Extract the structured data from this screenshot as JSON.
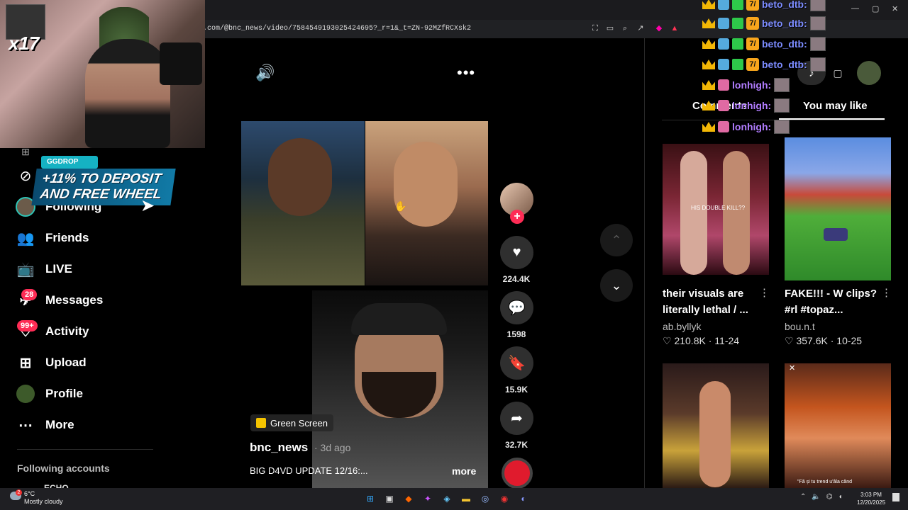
{
  "browser": {
    "url": "k.com/@bnc_news/video/7584549193025424695?_r=1&_t=ZN-92MZfRCXsk2",
    "window_controls": [
      "—",
      "▢",
      "✕"
    ]
  },
  "stream": {
    "viewer_multiplier": "x17",
    "promo_pill": "GGDROP",
    "promo_text": "+11% TO DEPOSIT AND FREE WHEEL"
  },
  "nav": {
    "items": [
      {
        "label": "Following",
        "icon": "following-avatar-icon"
      },
      {
        "label": "Friends",
        "icon": "friends-icon"
      },
      {
        "label": "LIVE",
        "icon": "live-tv-icon"
      },
      {
        "label": "Messages",
        "icon": "messages-icon",
        "badge": "28"
      },
      {
        "label": "Activity",
        "icon": "activity-icon",
        "badge": "99+"
      },
      {
        "label": "Upload",
        "icon": "upload-icon"
      },
      {
        "label": "Profile",
        "icon": "profile-avatar-icon"
      },
      {
        "label": "More",
        "icon": "more-icon"
      }
    ],
    "following_header": "Following accounts",
    "following_first": "ECHO"
  },
  "video": {
    "tag": "Green Screen",
    "author": "bnc_news",
    "date": "· 3d ago",
    "caption": "BIG D4VD UPDATE 12/16:...",
    "more_label": "more"
  },
  "actions": {
    "likes": "224.4K",
    "comments": "1598",
    "saves": "15.9K",
    "shares": "32.7K"
  },
  "right_panel": {
    "tab_comments": "Comments",
    "tab_you_may_like": "You may like",
    "cards": [
      {
        "title": "their visuals are literally lethal / ...",
        "author": "ab.byllyk",
        "likes": "210.8K",
        "date": "11-24"
      },
      {
        "title": "FAKE!!! - W clips? #rl #topaz...",
        "author": "bou.n.t",
        "likes": "357.6K",
        "date": "10-25"
      },
      {
        "title": "",
        "author": "",
        "likes": "",
        "date": ""
      },
      {
        "title": "",
        "author": "",
        "likes": "",
        "date": ""
      }
    ],
    "card_overlay_text_1": "HIS DOUBLE KILL??",
    "card_overlay_text_4": "\"Fă și tu trend u'âla când"
  },
  "chat": {
    "rows": [
      {
        "name": "beto_dtb:",
        "type": "b"
      },
      {
        "name": "beto_dtb:",
        "type": "b"
      },
      {
        "name": "beto_dtb:",
        "type": "b"
      },
      {
        "name": "beto_dtb:",
        "type": "b"
      },
      {
        "name": "lonhigh:",
        "type": "l"
      },
      {
        "name": "lonhigh:",
        "type": "l"
      },
      {
        "name": "lonhigh:",
        "type": "l"
      }
    ]
  },
  "taskbar": {
    "temp": "6°C",
    "weather": "Mostly cloudy",
    "time": "3:03 PM",
    "date": "12/20/2025",
    "weather_badge": "2"
  },
  "colors": {
    "accent": "#fe2c55",
    "panel_bg": "#000000",
    "action_bg": "#2f2f2f"
  }
}
